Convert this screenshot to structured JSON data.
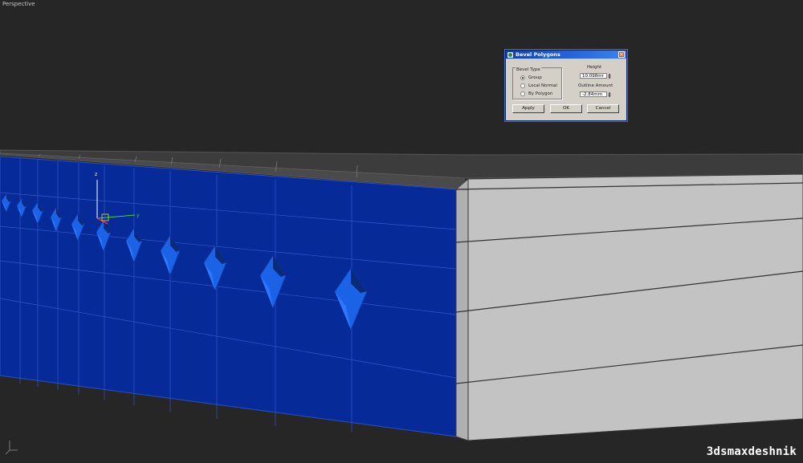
{
  "viewport": {
    "label": "Perspective",
    "axis_labels": {
      "z": "z",
      "y": "y"
    },
    "colors": {
      "background": "#262626",
      "selection_fill": "#0a2e9a",
      "object_gray": "#c3c3c3",
      "top_face": "#3c3c3c"
    },
    "icons": [
      "world-axis-gizmo-icon",
      "transform-gizmo-icon"
    ]
  },
  "dialog": {
    "title": "Bevel Polygons",
    "title_icon": "3dsmax-app-icon",
    "close_icon": "close-icon",
    "bevel_type_label": "Bevel Type",
    "bevel_options": [
      {
        "label": "Group",
        "selected": true
      },
      {
        "label": "Local Normal",
        "selected": false
      },
      {
        "label": "By Polygon",
        "selected": false
      }
    ],
    "height_label": "Height",
    "height_value": "10.098mr",
    "outline_label": "Outline Amount",
    "outline_value": "-2.84mm",
    "buttons": {
      "apply": "Apply",
      "ok": "OK",
      "cancel": "Cancel"
    }
  },
  "watermark": "3dsmaxdeshnik"
}
